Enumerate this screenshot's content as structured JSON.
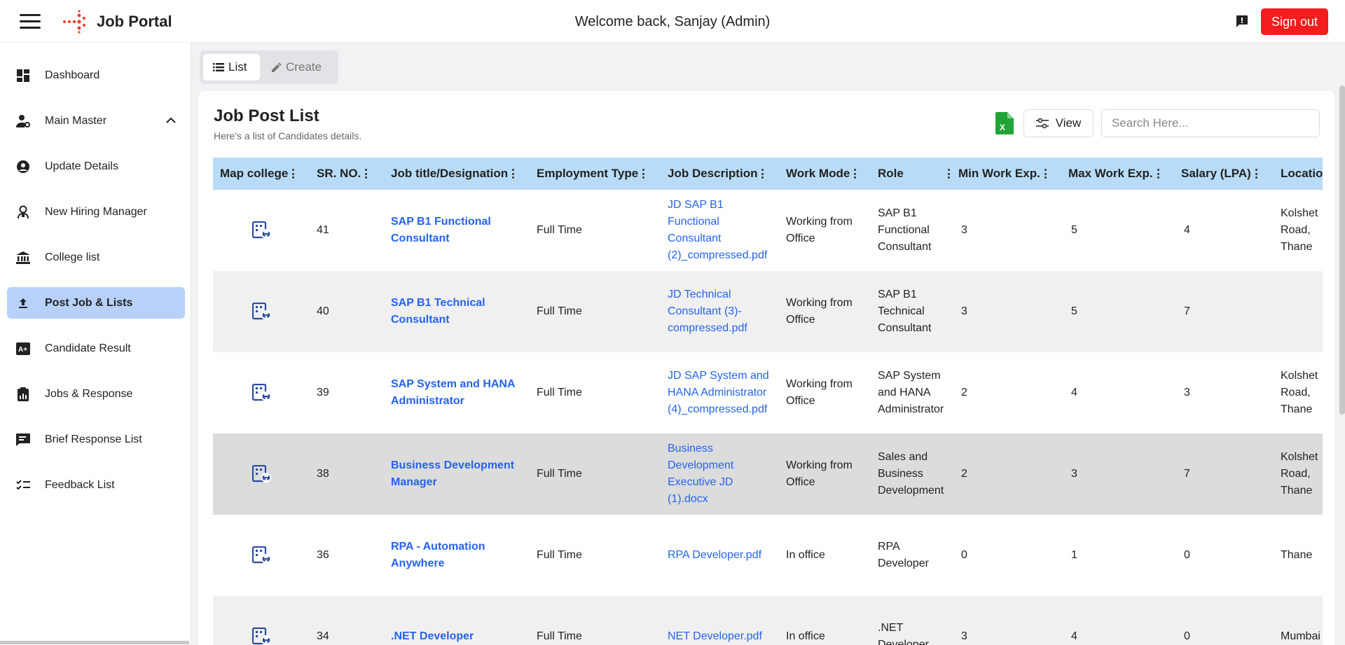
{
  "header": {
    "app_title": "Job Portal",
    "welcome": "Welcome back, Sanjay (Admin)",
    "signout_label": "Sign out"
  },
  "sidebar": {
    "items": [
      {
        "label": "Dashboard",
        "icon": "dashboard-icon"
      },
      {
        "label": "Main Master",
        "icon": "person-settings-icon"
      },
      {
        "label": "Update Details",
        "icon": "account-circle-icon"
      },
      {
        "label": "New Hiring Manager",
        "icon": "user-badge-icon"
      },
      {
        "label": "College list",
        "icon": "institution-icon"
      },
      {
        "label": "Post Job & Lists",
        "icon": "upload-icon",
        "active": true
      },
      {
        "label": "Candidate Result",
        "icon": "grade-icon"
      },
      {
        "label": "Jobs & Response",
        "icon": "clipboard-icon"
      },
      {
        "label": "Brief Response List",
        "icon": "chat-list-icon"
      },
      {
        "label": "Feedback List",
        "icon": "checklist-icon"
      }
    ]
  },
  "tabs": {
    "list": "List",
    "create": "Create"
  },
  "card": {
    "title": "Job Post List",
    "subtitle": "Here's a list of Candidates details.",
    "view_label": "View",
    "search_placeholder": "Search Here..."
  },
  "table": {
    "columns": [
      "Map college",
      "SR. NO.",
      "Job title/Designation",
      "Employment Type",
      "Job Description",
      "Work Mode",
      "Role",
      "Min Work Exp.",
      "Max Work Exp.",
      "Salary (LPA)",
      "Location"
    ],
    "rows": [
      {
        "sr": "41",
        "title": "SAP B1 Functional Consultant",
        "type": "Full Time",
        "jd": "JD SAP B1 Functional Consultant (2)_compressed.pdf",
        "mode": "Working from Office",
        "role": "SAP B1 Functional Consultant",
        "min": "3",
        "max": "5",
        "salary": "4",
        "location": "Kolshet Road, Thane"
      },
      {
        "sr": "40",
        "title": "SAP B1 Technical Consultant",
        "type": "Full Time",
        "jd": "JD Technical Consultant (3)-compressed.pdf",
        "mode": "Working from Office",
        "role": "SAP B1 Technical Consultant",
        "min": "3",
        "max": "5",
        "salary": "7",
        "location": ""
      },
      {
        "sr": "39",
        "title": "SAP System and HANA Administrator",
        "type": "Full Time",
        "jd": "JD SAP System and HANA Administrator (4)_compressed.pdf",
        "mode": "Working from Office",
        "role": "SAP System and HANA Administrator",
        "min": "2",
        "max": "4",
        "salary": "3",
        "location": "Kolshet Road, Thane"
      },
      {
        "sr": "38",
        "title": "Business Development Manager",
        "type": "Full Time",
        "jd": "Business Development Executive JD (1).docx",
        "mode": "Working from Office",
        "role": "Sales and Business Development",
        "min": "2",
        "max": "3",
        "salary": "7",
        "location": "Kolshet Road, Thane"
      },
      {
        "sr": "36",
        "title": "RPA - Automation Anywhere",
        "type": "Full Time",
        "jd": "RPA Developer.pdf",
        "mode": "In office",
        "role": "RPA Developer",
        "min": "0",
        "max": "1",
        "salary": "0",
        "location": "Thane"
      },
      {
        "sr": "34",
        "title": ".NET Developer",
        "type": "Full Time",
        "jd": "NET Developer.pdf",
        "mode": "In office",
        "role": ".NET Developer",
        "min": "3",
        "max": "4",
        "salary": "0",
        "location": "Mumbai"
      }
    ]
  },
  "colors": {
    "accent": "#2563eb",
    "signout": "#f41c1c",
    "header_row": "#b8dcf8",
    "active_nav": "#b7d1fb",
    "excel": "#21a336"
  }
}
